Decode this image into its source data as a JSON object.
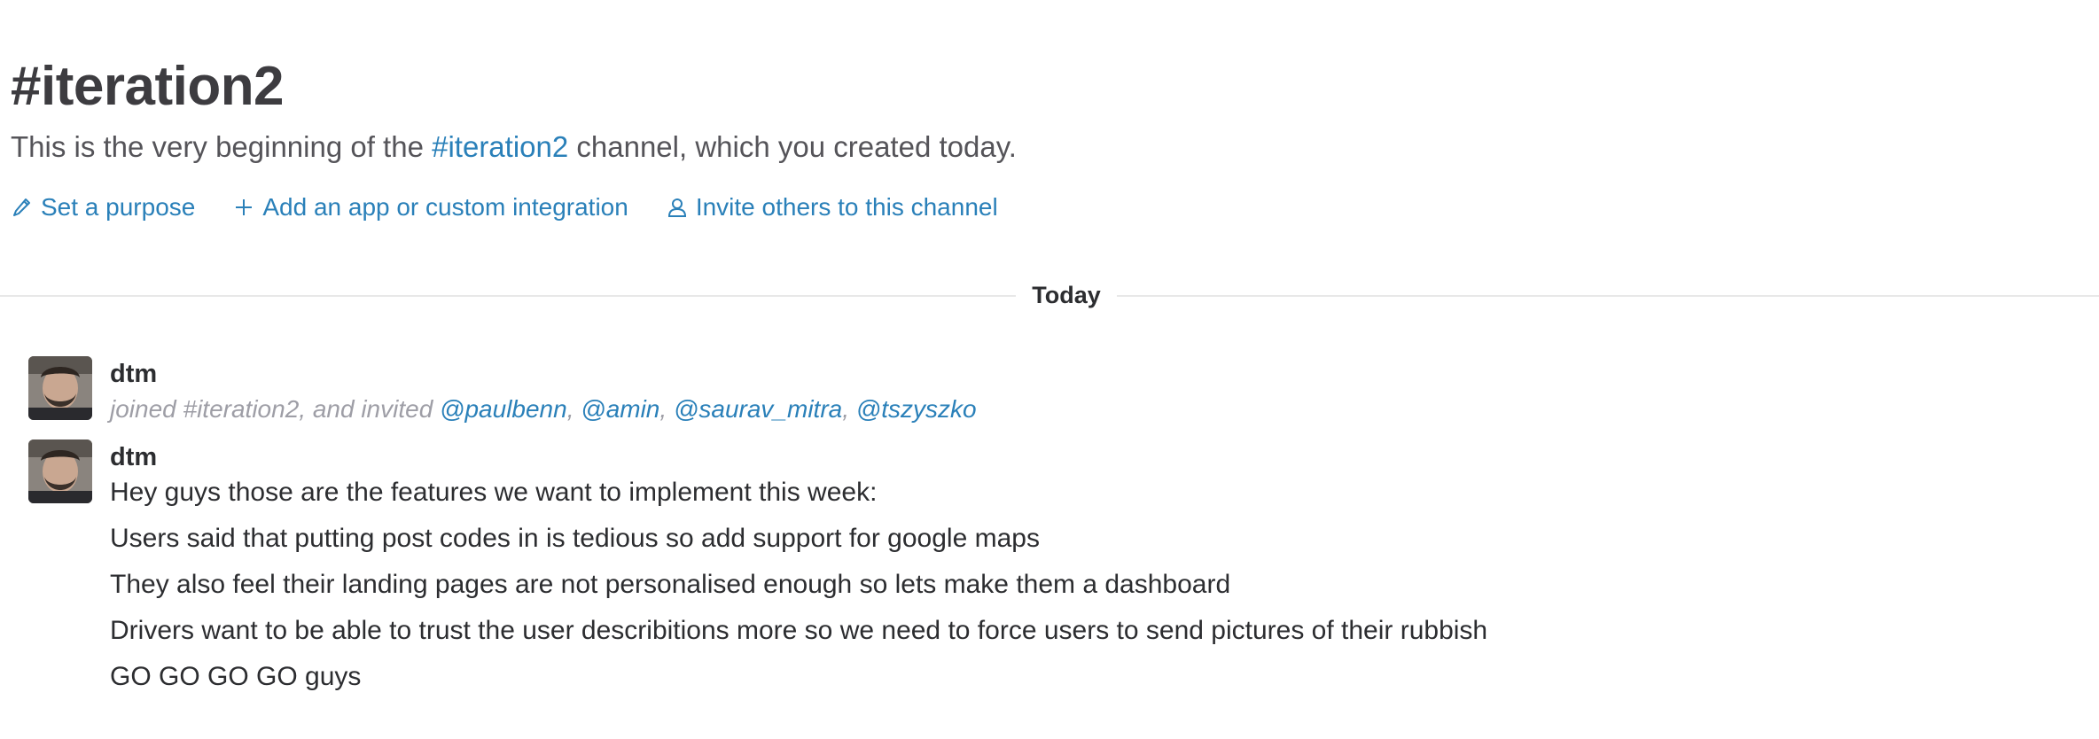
{
  "channel": {
    "title": "#iteration2",
    "intro_prefix": "This is the very beginning of the ",
    "intro_channel_link": "#iteration2",
    "intro_suffix": " channel, which you created today."
  },
  "actions": {
    "set_purpose": {
      "label": "Set a purpose",
      "icon": "pencil-icon"
    },
    "add_integration": {
      "label": "Add an app or custom integration",
      "icon": "plus-icon"
    },
    "invite": {
      "label": "Invite others to this channel",
      "icon": "person-icon"
    }
  },
  "divider": {
    "label": "Today"
  },
  "messages": [
    {
      "sender": "dtm",
      "type": "system",
      "system_text": "joined #iteration2, and invited ",
      "mentions": [
        "@paulbenn",
        "@amin",
        "@saurav_mitra",
        "@tszyszko"
      ],
      "separator": ","
    },
    {
      "sender": "dtm",
      "type": "text",
      "lines": [
        "Hey guys those are the features we want to implement this week:",
        "Users said that putting post codes in is tedious so add support for google maps",
        "They also feel their landing pages are not personalised enough so lets make them a dashboard",
        "Drivers want to be able to trust the user describitions more so we need to force users to send pictures of their rubbish",
        "GO GO GO GO guys"
      ]
    }
  ],
  "colors": {
    "link": "#2a80b9",
    "text": "#2c2d30",
    "muted": "#9e9ea6",
    "divider": "#e8e8e8"
  }
}
